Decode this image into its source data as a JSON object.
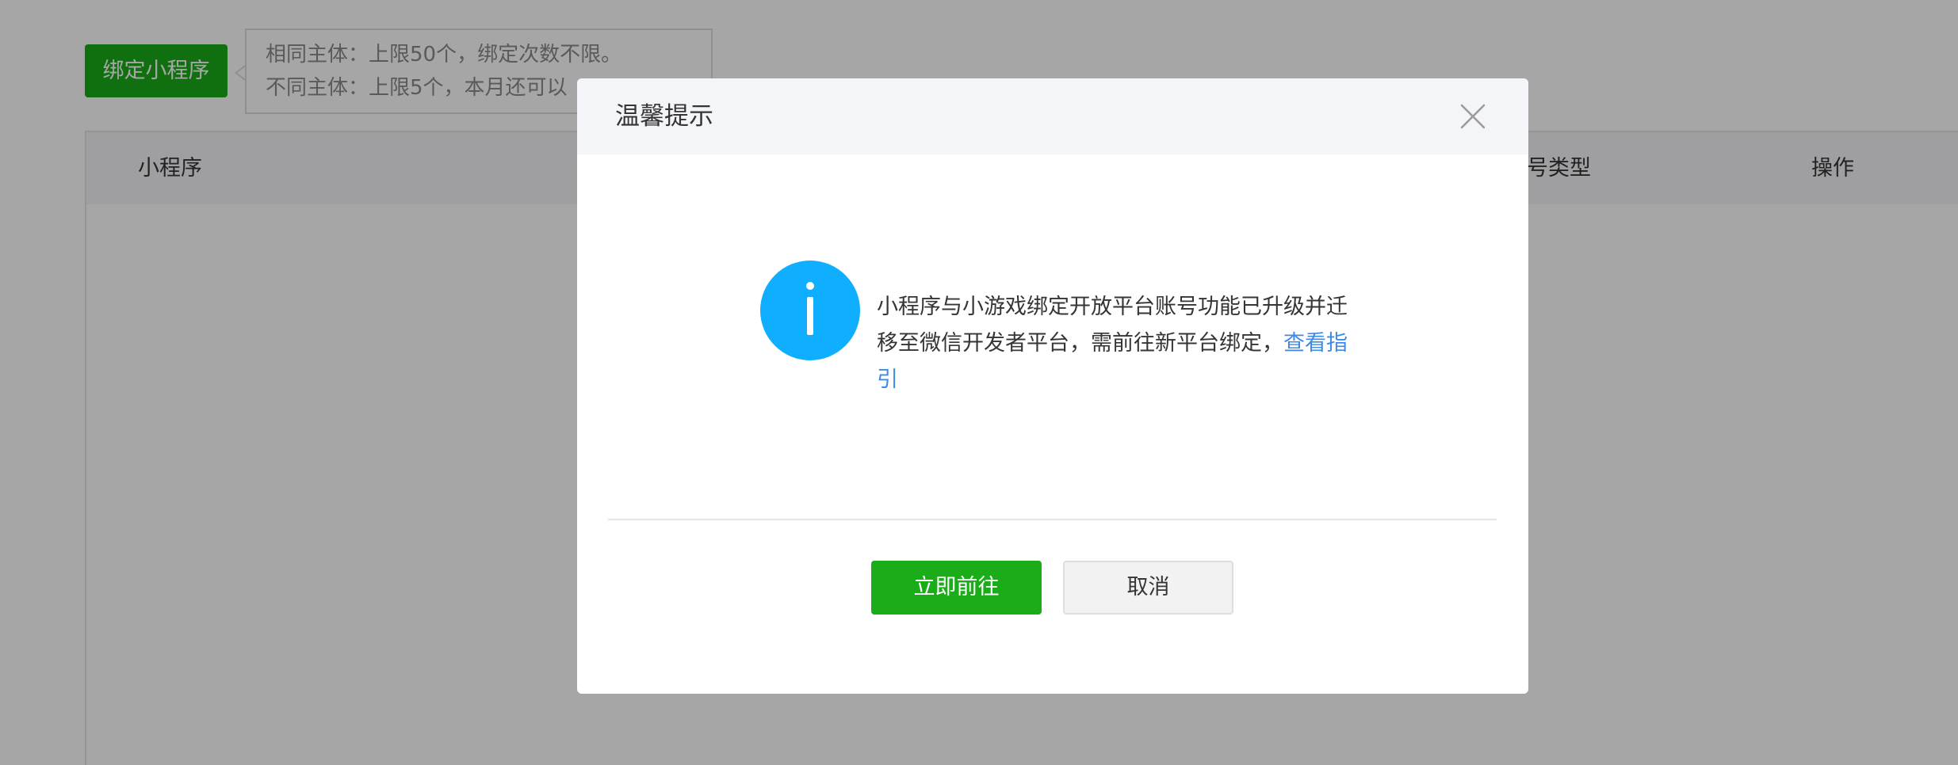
{
  "background": {
    "bind_button_label": "绑定小程序",
    "tip_line_1": "相同主体：上限50个，绑定次数不限。",
    "tip_line_2": "不同主体：上限5个，本月还可以",
    "table": {
      "col_mini_program": "小程序",
      "col_account_type": "账号类型",
      "col_actions": "操作"
    }
  },
  "dialog": {
    "title": "温馨提示",
    "close_icon": "close-icon",
    "info_icon": "info-icon",
    "message_text": "小程序与小游戏绑定开放平台账号功能已升级并迁移至微信开发者平台，需前往新平台绑定，",
    "message_link": "查看指引",
    "confirm_label": "立即前往",
    "cancel_label": "取消"
  },
  "colors": {
    "primary_green": "#1aad19",
    "info_blue": "#10aeff",
    "link_blue": "#3d8be9"
  }
}
